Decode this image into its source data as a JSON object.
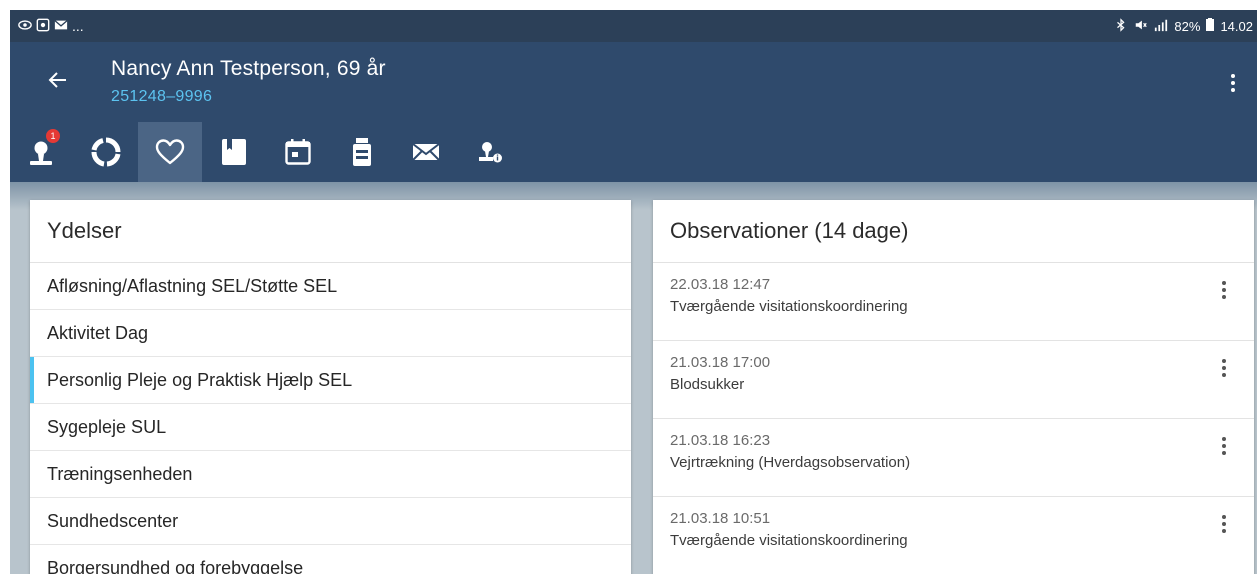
{
  "statusbar": {
    "left_text": "...",
    "battery": "82%",
    "time": "14.02"
  },
  "patient": {
    "name": "Nancy Ann Testperson, 69 år",
    "cpr": "251248‒9996"
  },
  "toolbar": {
    "badge": "1",
    "active": "heart-icon"
  },
  "services": {
    "title": "Ydelser",
    "items": [
      "Afløsning/Aflastning SEL/Støtte SEL",
      "Aktivitet Dag",
      "Personlig Pleje og Praktisk Hjælp SEL",
      "Sygepleje SUL",
      "Træningsenheden",
      "Sundhedscenter",
      "Borgersundhed og forebyggelse"
    ],
    "selected_index": 2
  },
  "observations": {
    "title": "Observationer (14 dage)",
    "items": [
      {
        "date": "22.03.18 12:47",
        "text": "Tværgående visitationskoordinering"
      },
      {
        "date": "21.03.18 17:00",
        "text": "Blodsukker"
      },
      {
        "date": "21.03.18 16:23",
        "text": "Vejrtrækning (Hverdagsobservation)"
      },
      {
        "date": "21.03.18 10:51",
        "text": "Tværgående visitationskoordinering"
      }
    ]
  },
  "colors": {
    "header": "#2f4a6c",
    "accent": "#4cc2f0",
    "cpr": "#5cc3f0",
    "badge": "#e53935"
  }
}
